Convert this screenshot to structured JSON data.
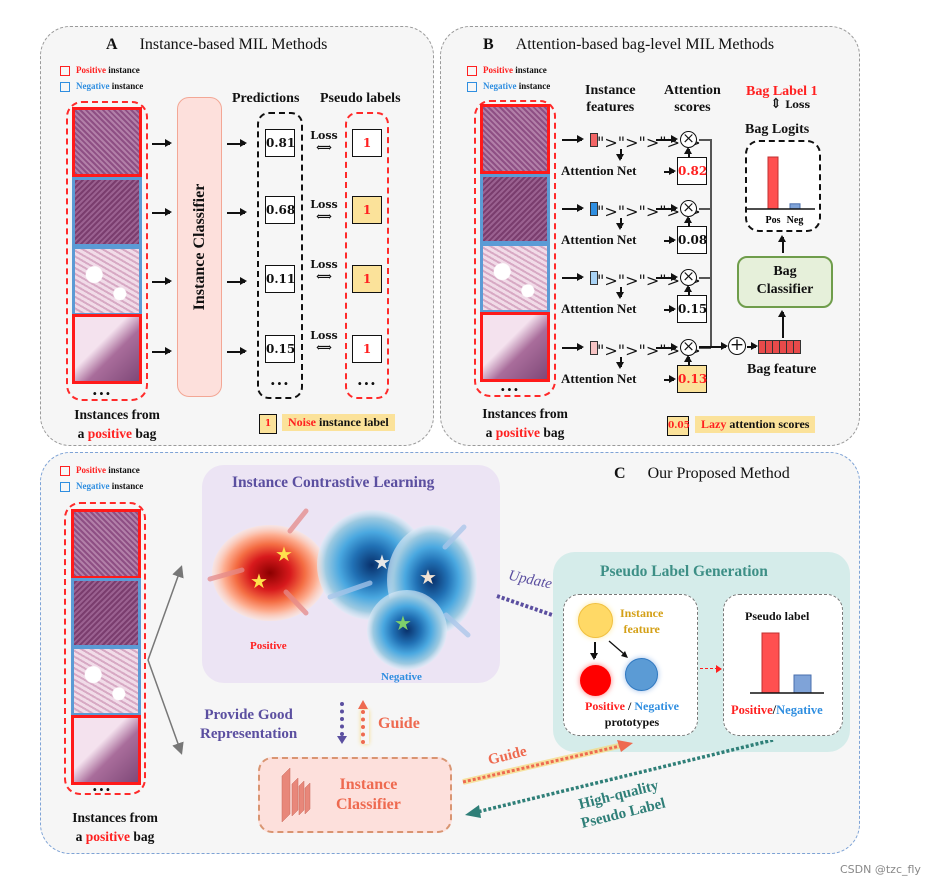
{
  "panel_a": {
    "letter": "A",
    "title": "Instance-based MIL Methods",
    "legend": {
      "positive_word": "Positive",
      "negative_word": "Negative",
      "suffix": "instance"
    },
    "classifier_label": "Instance Classifier",
    "predictions_header": "Predictions",
    "pseudo_labels_header": "Pseudo labels",
    "predictions": [
      "0.81",
      "0.68",
      "0.11",
      "0.15"
    ],
    "pseudo_labels": [
      {
        "value": "1",
        "noise": false
      },
      {
        "value": "1",
        "noise": true
      },
      {
        "value": "1",
        "noise": true
      },
      {
        "value": "1",
        "noise": false
      }
    ],
    "loss_label": "Loss",
    "ellipsis": "...",
    "caption_line1": "Instances from",
    "caption_a": "a",
    "caption_positive": "positive",
    "caption_bag": "bag",
    "key_value": "1",
    "key_word": "Noise",
    "key_rest": "instance label"
  },
  "panel_b": {
    "letter": "B",
    "title": "Attention-based bag-level MIL Methods",
    "legend": {
      "positive_word": "Positive",
      "negative_word": "Negative",
      "suffix": "instance"
    },
    "instance_features_header": [
      "Instance",
      "features"
    ],
    "attention_scores_header": [
      "Attention",
      "scores"
    ],
    "attention_net_label": "Attention Net",
    "attention_scores": [
      {
        "value": "0.82",
        "lazy": false,
        "highlight": true
      },
      {
        "value": "0.08",
        "lazy": false,
        "highlight": false
      },
      {
        "value": "0.15",
        "lazy": false,
        "highlight": false
      },
      {
        "value": "0.13",
        "lazy": true,
        "highlight": true
      }
    ],
    "feature_colors": [
      "#f26565",
      "#2f8ee0",
      "#a9d3f5",
      "#f7c4c4"
    ],
    "bag_label": "Bag Label 1",
    "loss_label": "Loss",
    "bag_logits_title": "Bag Logits",
    "bag_logits": {
      "categories": [
        "Pos",
        "Neg"
      ],
      "values": [
        1.0,
        0.1
      ],
      "colors": [
        "#ff5050",
        "#7fa3d8"
      ]
    },
    "bag_classifier": [
      "Bag",
      "Classifier"
    ],
    "bag_feature_label": "Bag feature",
    "ellipsis": "...",
    "caption_line1": "Instances from",
    "caption_a": "a",
    "caption_positive": "positive",
    "caption_bag": "bag",
    "key_value": "0.05",
    "key_word": "Lazy",
    "key_rest": "attention scores"
  },
  "panel_c": {
    "letter": "C",
    "title": "Our Proposed Method",
    "legend": {
      "positive_word": "Positive",
      "negative_word": "Negative",
      "suffix": "instance"
    },
    "icl_title": "Instance Contrastive Learning",
    "positive_label": "Positive",
    "negative_label": "Negative",
    "provide_label": [
      "Provide Good",
      "Representation"
    ],
    "guide_label": "Guide",
    "update_label": "Update",
    "plg_title": "Pseudo Label Generation",
    "instance_feature_label": [
      "Instance",
      "feature"
    ],
    "prototypes_positive": "Positive",
    "prototypes_sep": " / ",
    "prototypes_negative": "Negative",
    "prototypes_word": "prototypes",
    "pseudo_label_title": "Pseudo label",
    "pseudo_label_bars": {
      "categories": [
        "Positive",
        "Negative"
      ],
      "values": [
        1.0,
        0.3
      ],
      "colors": [
        "#ff5050",
        "#7fa3d8"
      ]
    },
    "pseudo_pos": "Positive",
    "pseudo_slash": "/",
    "pseudo_neg": "Negative",
    "instance_classifier": [
      "Instance",
      "Classifier"
    ],
    "guide2_label": "Guide",
    "hq_label": [
      "High-quality",
      "Pseudo Label"
    ],
    "ellipsis": "...",
    "caption_line1": "Instances from",
    "caption_a": "a",
    "caption_positive": "positive",
    "caption_bag": "bag"
  },
  "colors": {
    "positive": "#ff2020",
    "negative": "#2f8ee0",
    "noise_fill": "#fbe29a",
    "icl_title": "#5b4fa0",
    "plg_title": "#3d8f86",
    "guide": "#ee6a50",
    "hq": "#2f7f78"
  },
  "watermark": "CSDN @tzc_fly"
}
